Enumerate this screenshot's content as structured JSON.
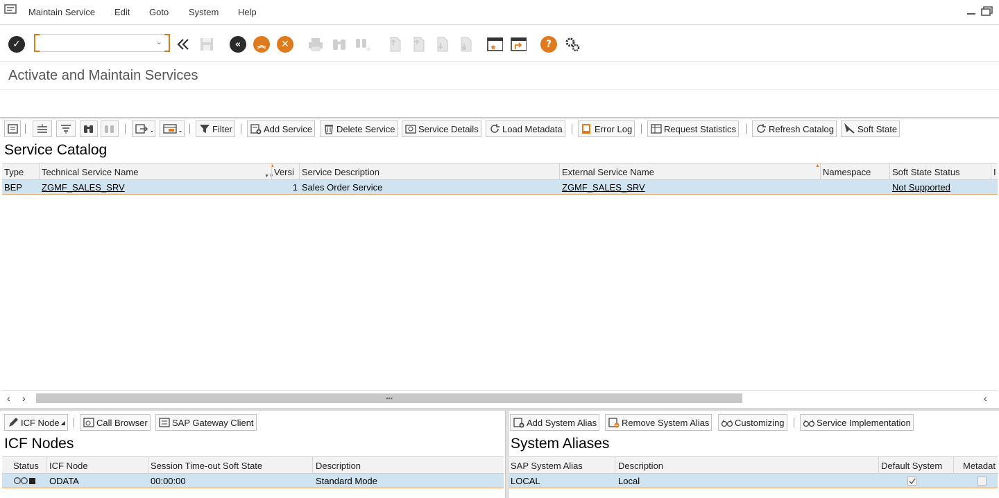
{
  "menubar": {
    "items": [
      "Maintain Service",
      "Edit",
      "Goto",
      "System",
      "Help"
    ],
    "icons": [
      "app-menu-icon",
      "restore-window-icon",
      "maximize-window-icon"
    ]
  },
  "toolbar": {
    "command_value": "",
    "icons": [
      "enter-check-icon",
      "collapse-cmd-icon",
      "save-icon",
      "back-icon",
      "exit-icon",
      "cancel-icon",
      "print-icon",
      "find-icon",
      "find-next-icon",
      "first-page-icon",
      "previous-page-icon",
      "next-page-icon",
      "last-page-icon",
      "create-session-icon",
      "shortcut-icon",
      "help-icon",
      "settings-icon"
    ]
  },
  "page": {
    "title": "Activate and Maintain Services"
  },
  "catalog_bar": {
    "buttons": [
      "Filter",
      "Add Service",
      "Delete Service",
      "Service Details",
      "Load Metadata",
      "Error Log",
      "Request Statistics",
      "Refresh Catalog",
      "Soft State"
    ]
  },
  "catalog": {
    "title": "Service Catalog",
    "columns": [
      "Type",
      "Technical Service Name",
      "Versi",
      "Service Description",
      "External Service Name",
      "Namespace",
      "Soft State Status",
      "I"
    ],
    "rows": [
      {
        "type": "BEP",
        "technical_name": "ZGMF_SALES_SRV",
        "version": "1",
        "description": "Sales Order Service",
        "external_name": "ZGMF_SALES_SRV",
        "namespace": "",
        "soft_state": "Not Supported"
      }
    ]
  },
  "icf_bar": {
    "buttons": [
      "ICF Node",
      "Call Browser",
      "SAP Gateway Client"
    ]
  },
  "icf": {
    "title": "ICF Nodes",
    "columns": [
      "Status",
      "ICF Node",
      "Session Time-out Soft State",
      "Description"
    ],
    "rows": [
      {
        "node": "ODATA",
        "timeout": "00:00:00",
        "description": "Standard Mode"
      }
    ]
  },
  "alias_bar": {
    "buttons": [
      "Add System Alias",
      "Remove System Alias",
      "Customizing",
      "Service Implementation"
    ]
  },
  "aliases": {
    "title": "System Aliases",
    "columns": [
      "SAP System Alias",
      "Description",
      "Default System",
      "Metadat"
    ],
    "rows": [
      {
        "alias": "LOCAL",
        "description": "Local",
        "default": true,
        "metadata": false
      }
    ]
  },
  "colors": {
    "accent": "#e07a1f",
    "selection": "#cfe3f1",
    "dark_icon": "#2b2b2b"
  }
}
